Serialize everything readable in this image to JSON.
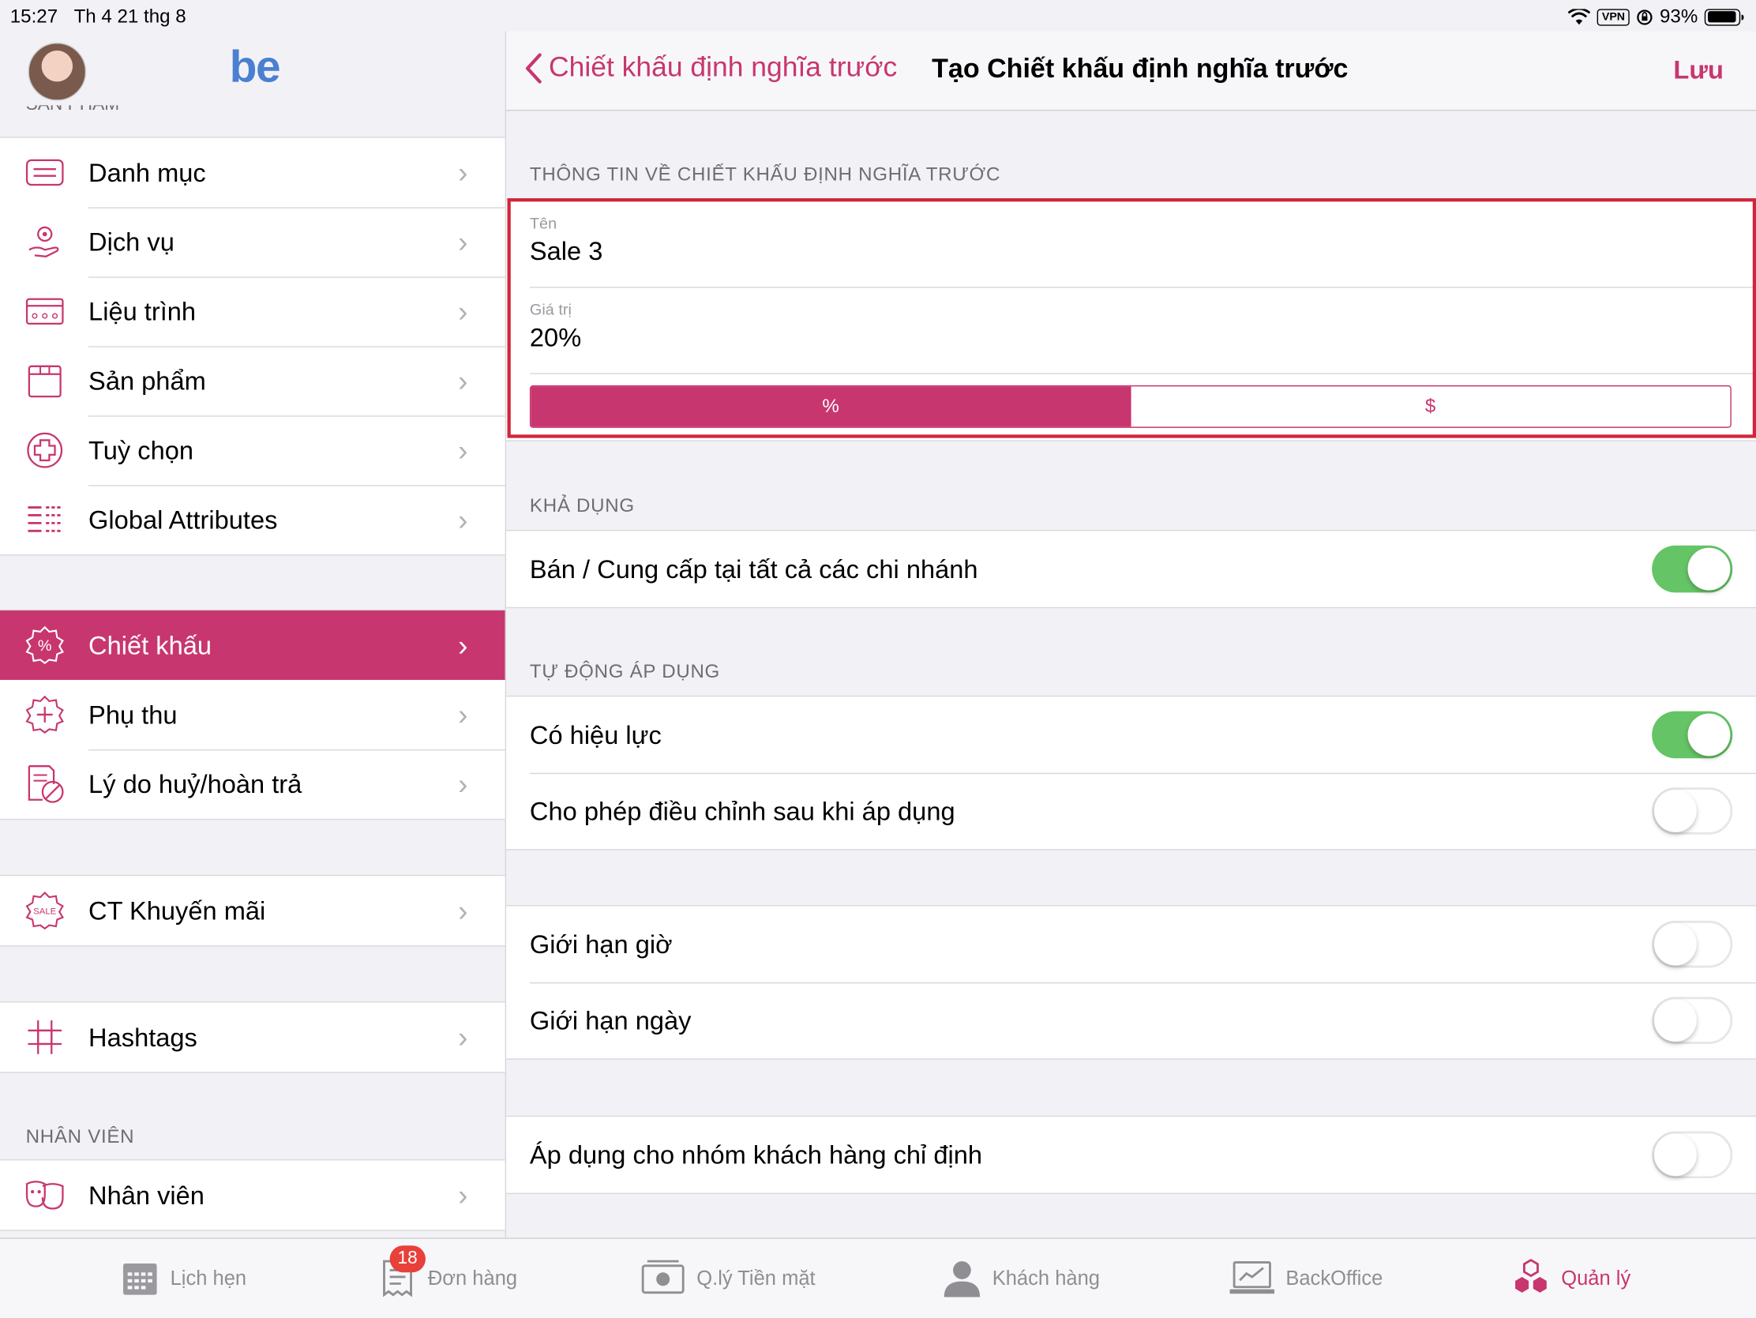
{
  "status": {
    "time": "15:27",
    "date": "Th 4 21 thg 8",
    "vpn": "VPN",
    "battery": "93%"
  },
  "sidebar": {
    "logo": "be",
    "section_top": "SẢN PHẨM",
    "group1": [
      {
        "label": "Danh mục",
        "icon": "list-card-icon"
      },
      {
        "label": "Dịch vụ",
        "icon": "service-hand-icon"
      },
      {
        "label": "Liệu trình",
        "icon": "treatment-card-icon"
      },
      {
        "label": "Sản phẩm",
        "icon": "product-box-icon"
      },
      {
        "label": "Tuỳ chọn",
        "icon": "option-plus-icon"
      },
      {
        "label": "Global Attributes",
        "icon": "attributes-list-icon"
      }
    ],
    "group2": [
      {
        "label": "Chiết khấu",
        "icon": "discount-badge-icon",
        "active": true
      },
      {
        "label": "Phụ thu",
        "icon": "surcharge-badge-icon"
      },
      {
        "label": "Lý do huỷ/hoàn trả",
        "icon": "cancel-document-icon"
      }
    ],
    "group3": [
      {
        "label": "CT Khuyến mãi",
        "icon": "sale-badge-icon"
      }
    ],
    "group4": [
      {
        "label": "Hashtags",
        "icon": "hashtag-icon"
      }
    ],
    "section_staff": "NHÂN VIÊN",
    "group5": [
      {
        "label": "Nhân viên",
        "icon": "staff-masks-icon"
      }
    ]
  },
  "navbar": {
    "back_label": "Chiết khấu định nghĩa trước",
    "title": "Tạo Chiết khấu định nghĩa trước",
    "save_label": "Lưu"
  },
  "form": {
    "section_info": "THÔNG TIN VỀ CHIẾT KHẤU ĐỊNH NGHĨA TRƯỚC",
    "name_label": "Tên",
    "name_value": "Sale 3",
    "value_label": "Giá trị",
    "value_value": "20%",
    "seg_percent": "%",
    "seg_dollar": "$",
    "section_availability": "KHẢ DỤNG",
    "all_branches": "Bán / Cung cấp tại tất cả các chi nhánh",
    "section_auto": "TỰ ĐỘNG ÁP DỤNG",
    "effective": "Có hiệu lực",
    "allow_adjust": "Cho phép điều chỉnh sau khi áp dụng",
    "limit_hour": "Giới hạn giờ",
    "limit_day": "Giới hạn ngày",
    "customer_group": "Áp dụng cho nhóm khách hàng chỉ định"
  },
  "tabbar": {
    "tabs": [
      {
        "label": "Lịch hẹn"
      },
      {
        "label": "Đơn hàng",
        "badge": "18"
      },
      {
        "label": "Q.lý Tiền mặt"
      },
      {
        "label": "Khách hàng"
      },
      {
        "label": "BackOffice"
      },
      {
        "label": "Quản lý",
        "active": true
      }
    ]
  },
  "colors": {
    "accent": "#c8366f",
    "toggle_on": "#65c466",
    "highlight": "#d0253a"
  }
}
